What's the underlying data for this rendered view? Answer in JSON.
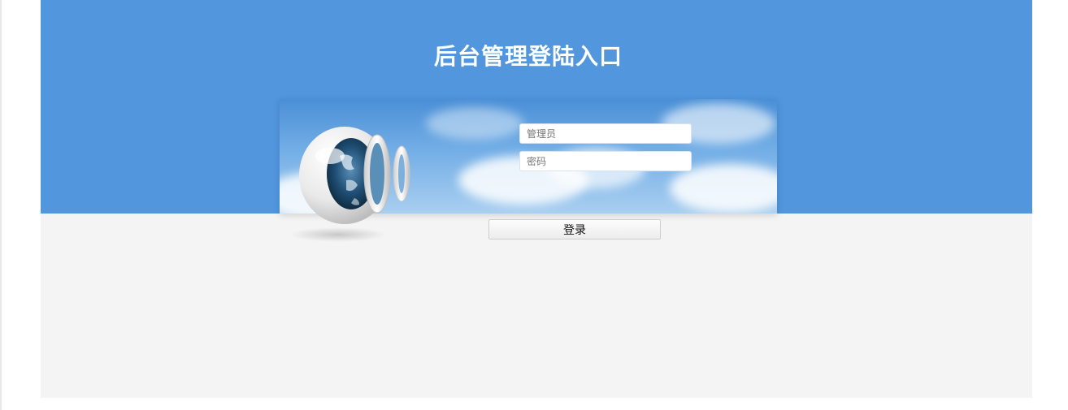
{
  "page": {
    "title": "后台管理登陆入口"
  },
  "login": {
    "username_placeholder": "管理员",
    "password_placeholder": "密码",
    "submit_label": "登录"
  },
  "colors": {
    "header_blue": "#5296de",
    "page_bg": "#f4f4f4"
  },
  "icons": {
    "logo": "globe-rings-icon"
  }
}
